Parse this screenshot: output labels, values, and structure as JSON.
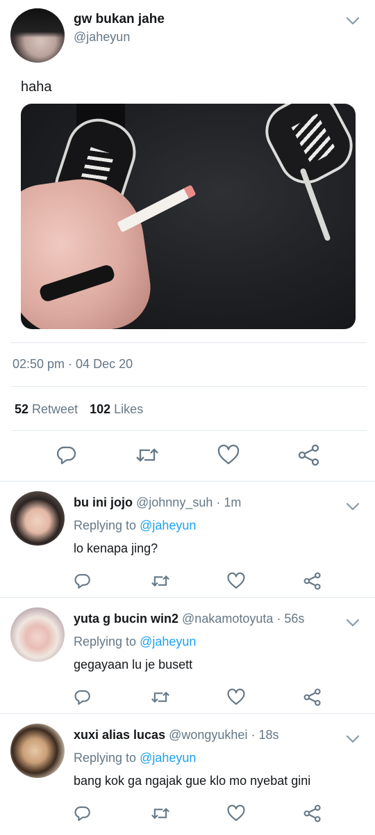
{
  "main_tweet": {
    "author_name": "gw bukan jahe",
    "author_handle": "@jaheyun",
    "text": "haha",
    "timestamp": "02:50 pm · 04 Dec 20",
    "retweet_count": "52",
    "retweet_label": "Retweet",
    "like_count": "102",
    "like_label": "Likes",
    "icons": [
      "reply-icon",
      "retweet-icon",
      "like-icon",
      "share-icon"
    ]
  },
  "replies": [
    {
      "name": "bu ini jojo",
      "handle": "@johnny_suh",
      "time": "· 1m",
      "replying_prefix": "Replying to",
      "replying_mention": "@jaheyun",
      "text": "lo kenapa jing?"
    },
    {
      "name": "yuta g bucin win2",
      "handle": "@nakamotoyuta",
      "time": "· 56s",
      "replying_prefix": "Replying to",
      "replying_mention": "@jaheyun",
      "text": "gegayaan lu je busett"
    },
    {
      "name": "xuxi alias lucas",
      "handle": "@wongyukhei",
      "time": "· 18s",
      "replying_prefix": "Replying to",
      "replying_mention": "@jaheyun",
      "text": "bang kok ga ngajak gue klo mo nyebat gini"
    }
  ],
  "colors": {
    "text": "#14171a",
    "secondary": "#657786",
    "link": "#1da1f2",
    "divider": "#e1e8ed",
    "icon": "#657786"
  }
}
